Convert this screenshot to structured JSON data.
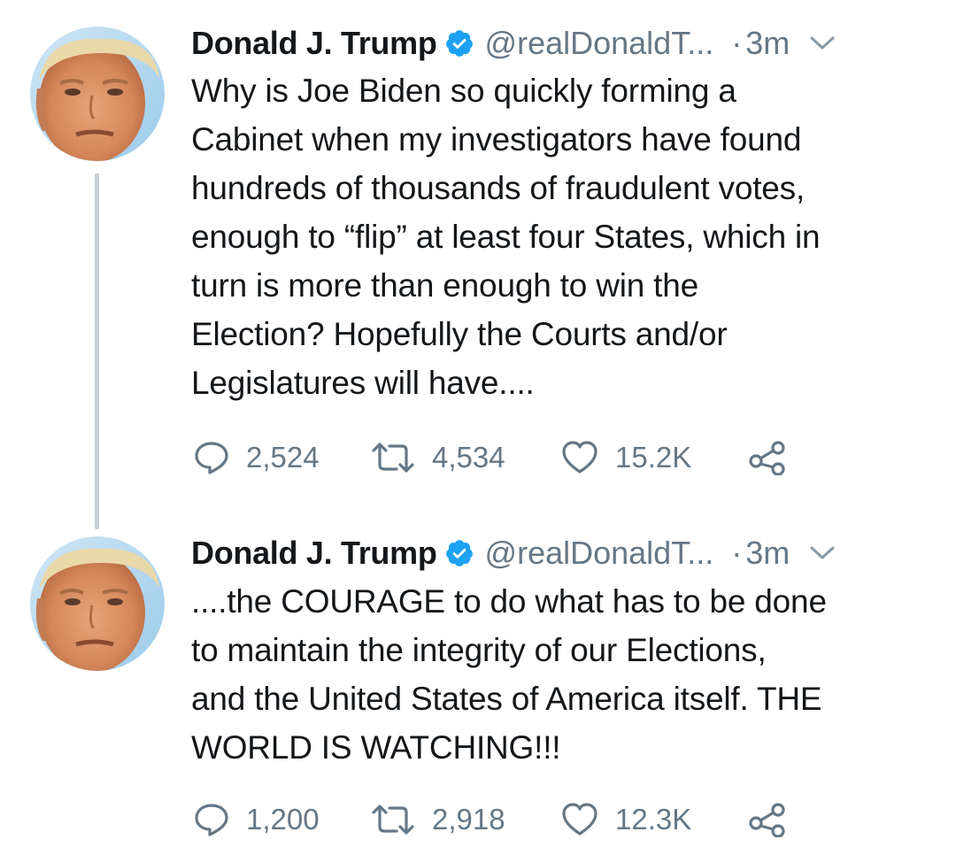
{
  "tweets": [
    {
      "author": {
        "name": "Donald J. Trump",
        "handle": "@realDonaldT...",
        "verified": true
      },
      "separator": "·",
      "time": "3m",
      "text_lines": [
        "Why is Joe Biden so quickly forming a",
        "Cabinet when my investigators have found",
        "hundreds of thousands of fraudulent votes,",
        "enough to “flip” at least four States, which in",
        "turn is more than enough to win the",
        "Election? Hopefully the Courts and/or",
        "Legislatures will have...."
      ],
      "stats": {
        "replies": "2,524",
        "retweets": "4,534",
        "likes": "15.2K"
      }
    },
    {
      "author": {
        "name": "Donald J. Trump",
        "handle": "@realDonaldT...",
        "verified": true
      },
      "separator": "·",
      "time": "3m",
      "text_lines": [
        "....the COURAGE to do what has to be done",
        "to maintain the integrity of our Elections,",
        "and the United States of America itself. THE",
        "WORLD IS WATCHING!!!"
      ],
      "stats": {
        "replies": "1,200",
        "retweets": "2,918",
        "likes": "12.3K"
      }
    }
  ],
  "colors": {
    "text": "#14171a",
    "secondary": "#657786",
    "verified": "#1da1f2",
    "thread_line": "#c4cfd6",
    "background": "#ffffff"
  },
  "icons": [
    "verified-badge-icon",
    "chevron-down-icon",
    "reply-icon",
    "retweet-icon",
    "like-icon",
    "share-icon"
  ]
}
